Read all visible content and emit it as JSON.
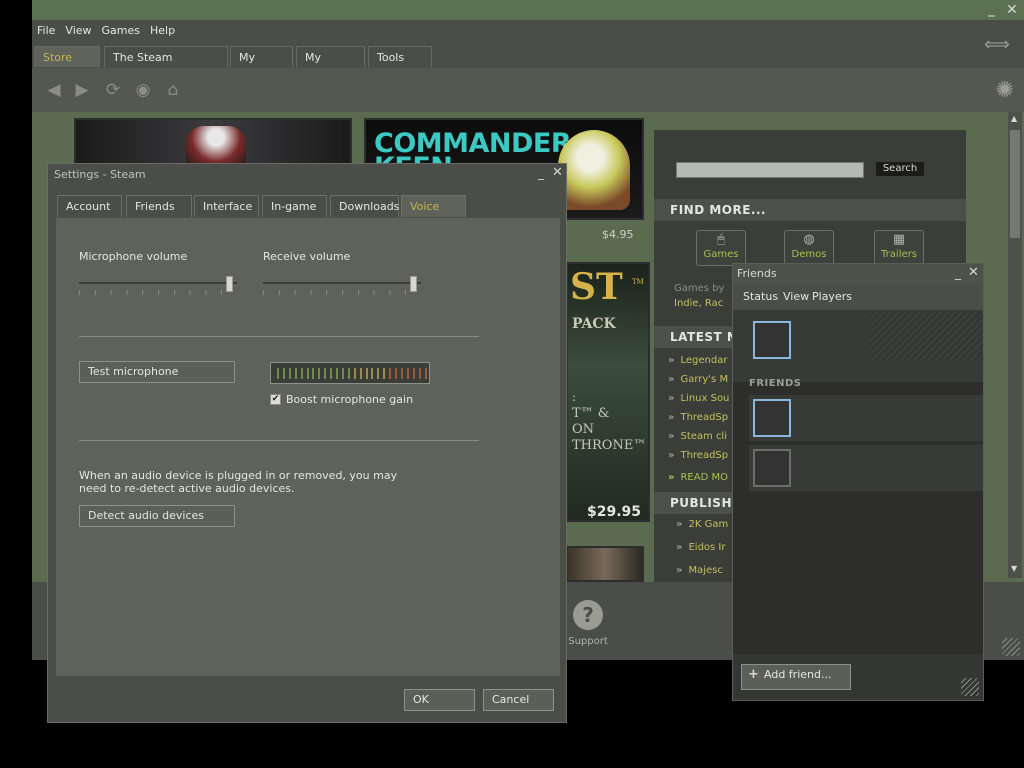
{
  "main": {
    "menu": [
      "File",
      "View",
      "Games",
      "Help"
    ],
    "tabs": [
      {
        "label": "Store",
        "active": true
      },
      {
        "label": "The Steam Community",
        "active": false
      },
      {
        "label": "My games",
        "active": false
      },
      {
        "label": "My media",
        "active": false
      },
      {
        "label": "Tools",
        "active": false
      }
    ],
    "toolbar_icons": [
      "back-icon",
      "forward-icon",
      "refresh-icon",
      "stop-icon",
      "home-icon"
    ],
    "window_controls": {
      "minimize": "_",
      "close": "✕"
    }
  },
  "store": {
    "keen_title": "COMMANDER KEEN",
    "keen_price": "$4.95",
    "poster_price": "$29.95",
    "poster_text": {
      "st": "ST",
      "tm": "TM",
      "pack": "PACK",
      "line1": ":",
      "line2": "T™ &",
      "line3": "ON",
      "line4": "THRONE™"
    },
    "search_button": "Search",
    "find_more": "FIND MORE...",
    "find_buttons": [
      {
        "label": "Games",
        "icon": "mouse-icon"
      },
      {
        "label": "Demos",
        "icon": "disc-icon"
      },
      {
        "label": "Trailers",
        "icon": "film-icon"
      }
    ],
    "games_by": "Games by",
    "genres": "Indie, Rac",
    "latest_news": "LATEST N",
    "news_items": [
      "Legendar",
      "Garry's M",
      "Linux Sou",
      "ThreadSp",
      "Steam cli",
      "ThreadSp"
    ],
    "read_more": "READ MO",
    "publishers": "PUBLISHE",
    "publisher_items": [
      "2K Gam",
      "Eidos Ir",
      "Majesc"
    ],
    "support_label": "Support"
  },
  "settings": {
    "title": "Settings - Steam",
    "tabs": [
      {
        "label": "Account",
        "active": false
      },
      {
        "label": "Friends",
        "active": false
      },
      {
        "label": "Interface",
        "active": false
      },
      {
        "label": "In-game",
        "active": false
      },
      {
        "label": "Downloads",
        "active": false
      },
      {
        "label": "Voice",
        "active": true
      }
    ],
    "mic_volume_label": "Microphone volume",
    "mic_volume_level": 0.97,
    "receive_volume_label": "Receive volume",
    "receive_volume_level": 0.97,
    "test_mic_button": "Test microphone",
    "boost_label": "Boost microphone gain",
    "boost_checked": true,
    "redetect_text": "When an audio device is plugged in or removed, you may need to re-detect active audio devices.",
    "detect_button": "Detect audio devices",
    "ok_button": "OK",
    "cancel_button": "Cancel"
  },
  "friends": {
    "title": "Friends",
    "menu": [
      "Status",
      "View",
      "Players"
    ],
    "section_header": "FRIENDS",
    "add_friend_button": "Add friend..."
  },
  "colors": {
    "accent": "#c4b550",
    "link": "#c4c060",
    "titlebar": "#5b7151"
  }
}
